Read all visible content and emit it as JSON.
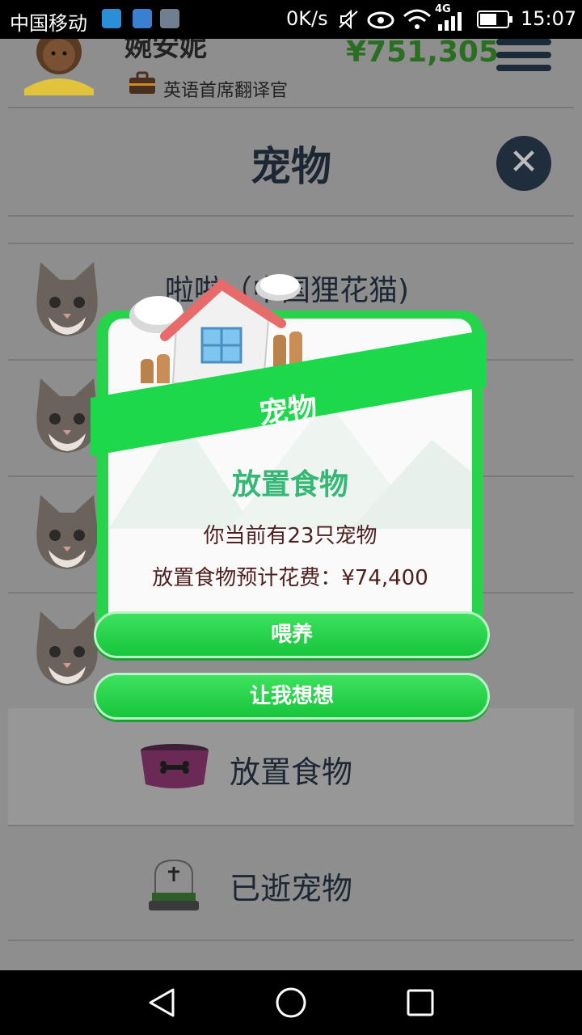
{
  "status_bar": {
    "carrier": "中国移动",
    "speed": "0K/s",
    "network": "4G",
    "time": "15:07"
  },
  "header": {
    "name": "婉安妮",
    "job": "英语首席翻译官",
    "money": "¥751,305"
  },
  "page": {
    "title": "宠物",
    "close_label": "✕"
  },
  "pets": [
    {
      "name": "啦啦（中国狸花猫)"
    }
  ],
  "menu": {
    "feed_label": "放置食物",
    "deceased_label": "已逝宠物"
  },
  "dialog": {
    "ribbon_title": "宠物",
    "title": "放置食物",
    "line1": "你当前有23只宠物",
    "line2": "放置食物预计花费：¥74,400",
    "feed_button": "喂养",
    "cancel_button": "让我想想"
  },
  "colors": {
    "accent_green": "#27d34a",
    "money_green": "#2a6e22",
    "dialog_title": "#35b876"
  }
}
